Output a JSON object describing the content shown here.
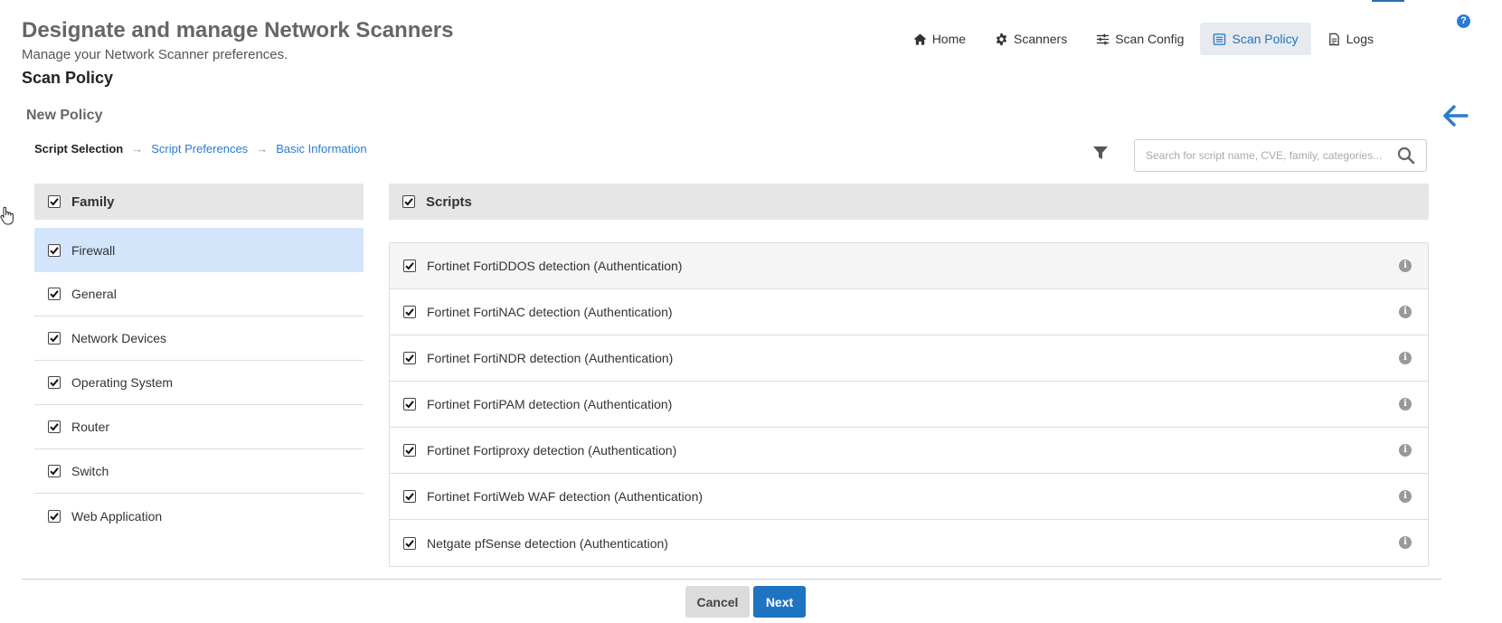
{
  "header": {
    "title": "Designate and manage Network Scanners",
    "subtitle": "Manage your Network Scanner preferences.",
    "section": "Scan Policy"
  },
  "nav": {
    "items": [
      {
        "label": "Home",
        "icon": "home-icon"
      },
      {
        "label": "Scanners",
        "icon": "gear-icon"
      },
      {
        "label": "Scan Config",
        "icon": "sliders-icon"
      },
      {
        "label": "Scan Policy",
        "icon": "list-icon",
        "active": true
      },
      {
        "label": "Logs",
        "icon": "document-icon"
      }
    ]
  },
  "help": {
    "glyph": "?"
  },
  "page": {
    "title": "New Policy"
  },
  "steps": {
    "current": "Script Selection",
    "step2": "Script Preferences",
    "step3": "Basic Information"
  },
  "search": {
    "placeholder": "Search for script name, CVE, family, categories...",
    "value": ""
  },
  "family": {
    "header": "Family",
    "items": [
      {
        "label": "Firewall",
        "checked": true,
        "selected": true
      },
      {
        "label": "General",
        "checked": true
      },
      {
        "label": "Network Devices",
        "checked": true
      },
      {
        "label": "Operating System",
        "checked": true
      },
      {
        "label": "Router",
        "checked": true
      },
      {
        "label": "Switch",
        "checked": true
      },
      {
        "label": "Web Application",
        "checked": true
      }
    ]
  },
  "scripts": {
    "header": "Scripts",
    "items": [
      {
        "label": "Fortinet FortiDDOS detection (Authentication)",
        "checked": true
      },
      {
        "label": "Fortinet FortiNAC detection (Authentication)",
        "checked": true
      },
      {
        "label": "Fortinet FortiNDR detection (Authentication)",
        "checked": true
      },
      {
        "label": "Fortinet FortiPAM detection (Authentication)",
        "checked": true
      },
      {
        "label": "Fortinet Fortiproxy detection (Authentication)",
        "checked": true
      },
      {
        "label": "Fortinet FortiWeb WAF detection (Authentication)",
        "checked": true
      },
      {
        "label": "Netgate pfSense detection (Authentication)",
        "checked": true
      }
    ],
    "info_glyph": "i"
  },
  "footer": {
    "cancel_label": "Cancel",
    "next_label": "Next"
  },
  "colors": {
    "accent": "#1f74c2",
    "selected_row": "#d3e5fb",
    "panel_header": "#e6e6e6"
  }
}
